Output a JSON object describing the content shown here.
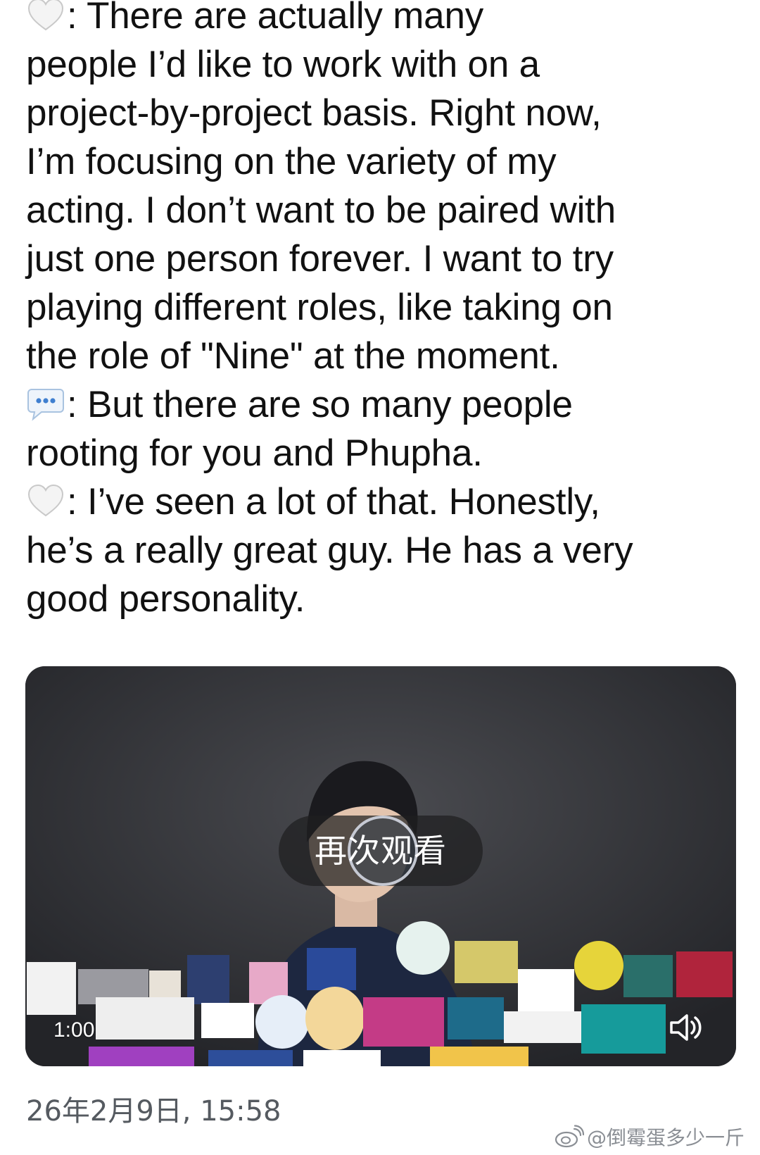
{
  "post": {
    "lines": [
      ": There are actually many",
      "people I’d like to work with on a",
      "project-by-project basis. Right now,",
      "I’m focusing on the variety of my",
      "acting. I don’t want to be paired with",
      "just one person forever. I want to try",
      "playing different roles, like taking on",
      "the role of \"Nine\" at the moment.",
      ": But there are so many people",
      "rooting for you and Phupha.",
      ": I’ve seen a lot of that. Honestly,",
      "he’s a really great guy. He has a very",
      "good personality."
    ],
    "line_icons": [
      "white-heart-icon",
      "",
      "",
      "",
      "",
      "",
      "",
      "",
      "speech-bubble-icon",
      "",
      "white-heart-icon",
      "",
      ""
    ]
  },
  "video": {
    "replay_label": "再次观看",
    "duration": "1:00",
    "volume_icon": "speaker-icon"
  },
  "meta": {
    "date": "26年2月9日, 15:58",
    "watermark": "@倒霉蛋多少一斤",
    "watermark_icon": "weibo-logo-icon"
  },
  "colors": {
    "text": "#111111",
    "date": "#555a60",
    "watermark": "#8a8e94",
    "video_bg": "#2a2b2f"
  }
}
